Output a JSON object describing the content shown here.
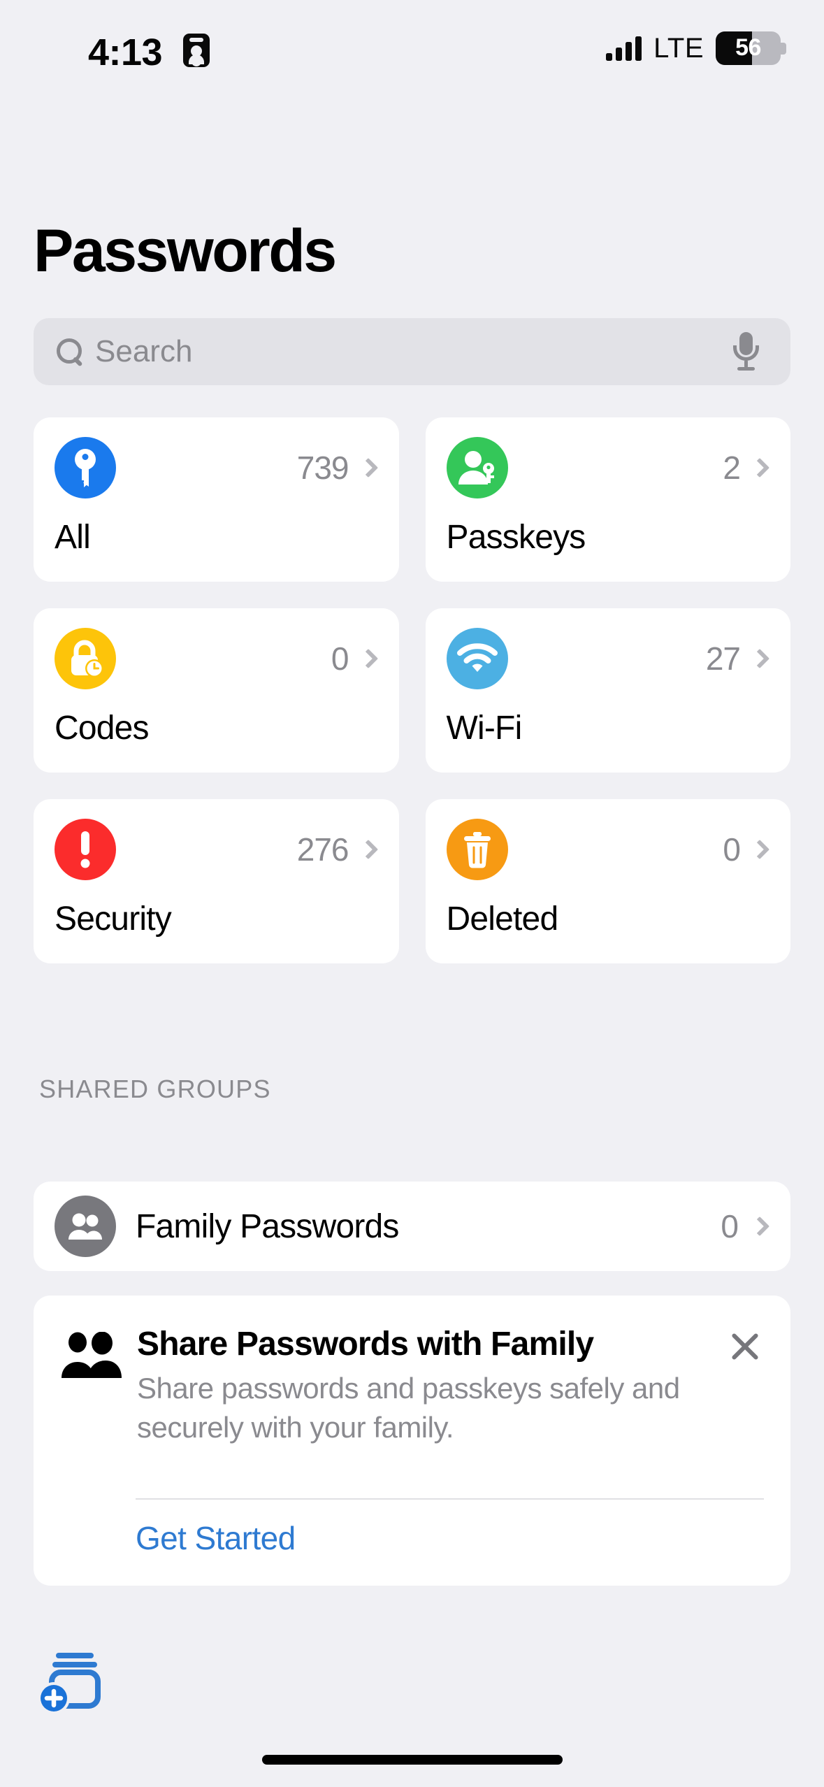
{
  "status_bar": {
    "time": "4:13",
    "recording_icon": "screen-recording-icon",
    "signal_icon": "cellular-signal-icon",
    "signal_bars": 4,
    "network": "LTE",
    "battery_percent": "56",
    "battery_level": 56
  },
  "header": {
    "title": "Passwords"
  },
  "search": {
    "placeholder": "Search",
    "value": "",
    "icon": "search-icon",
    "dictation_icon": "microphone-icon"
  },
  "categories": [
    {
      "label": "All",
      "count": "739",
      "icon": "key-icon",
      "color": "#1a7aed"
    },
    {
      "label": "Passkeys",
      "count": "2",
      "icon": "person-key-icon",
      "color": "#34c759"
    },
    {
      "label": "Codes",
      "count": "0",
      "icon": "lock-clock-icon",
      "color": "#fdc40a"
    },
    {
      "label": "Wi-Fi",
      "count": "27",
      "icon": "wifi-icon",
      "color": "#4cb0e3"
    },
    {
      "label": "Security",
      "count": "276",
      "icon": "exclamation-icon",
      "color": "#fb2c2c"
    },
    {
      "label": "Deleted",
      "count": "0",
      "icon": "trash-icon",
      "color": "#f79a13"
    }
  ],
  "shared_groups": {
    "header": "SHARED GROUPS",
    "items": [
      {
        "name": "Family Passwords",
        "count": "0",
        "icon": "two-people-icon",
        "color": "#78787d"
      }
    ]
  },
  "promo": {
    "icon": "two-people-filled-icon",
    "title": "Share Passwords with Family",
    "subtitle": "Share passwords and passkeys safely and securely with your family.",
    "cta": "Get Started",
    "close_icon": "close-icon"
  },
  "toolbar": {
    "add_icon": "rectangle-stack-badge-plus-icon",
    "accent_color": "#2e7ad1"
  }
}
